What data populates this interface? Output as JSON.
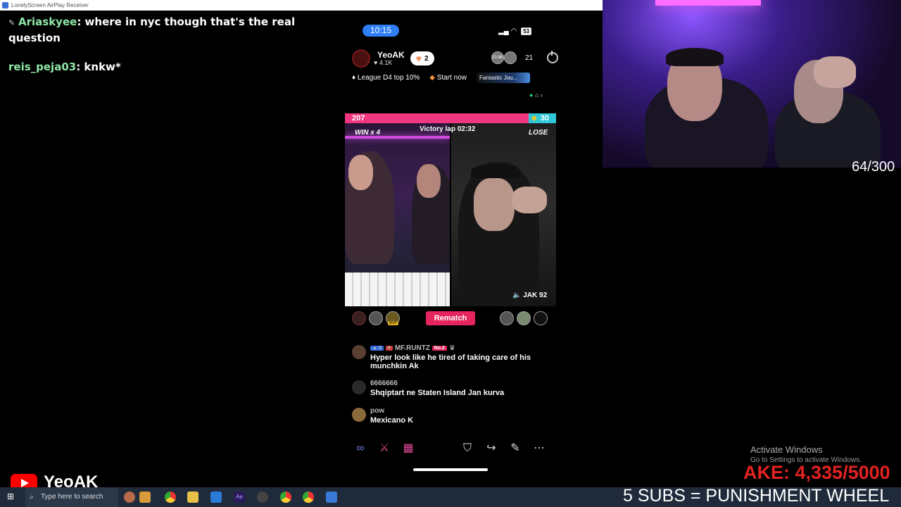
{
  "window": {
    "title": "LonelyScreen AirPlay Receiver"
  },
  "chat": [
    {
      "user": "Ariaskyee",
      "message": ": where in nyc though that's the real question"
    },
    {
      "user": "reis_peja03",
      "message": ": knkw*"
    }
  ],
  "phone": {
    "status": {
      "time": "10:15",
      "battery": "53"
    },
    "host": {
      "name": "YeoAK",
      "likes": "4.1K",
      "heart_count": "2"
    },
    "viewers": {
      "count": "21",
      "avatar_text": "10.8K"
    },
    "chips": {
      "league": "League D4 top 10%",
      "start": "Start now",
      "fantastic": "Fantastic Jou..."
    },
    "battle": {
      "score_left": "207",
      "score_right": "30",
      "left_ratio": 0.87,
      "win_label": "WIN x 4",
      "victory_text": "Victory lap 02:32",
      "lose_label": "LOSE",
      "opponent_tag": "JAK 92",
      "rematch_label": "Rematch",
      "mvp_label": "MVP"
    },
    "comments": [
      {
        "name": "MF.RUNTZ",
        "level": "3",
        "rank": "No.2",
        "text": "Hyper look like he tired of taking care of his munchkin Ak"
      },
      {
        "name": "6666666",
        "text": "Shqiptart ne Staten Island Jan kurva"
      },
      {
        "name": "pow",
        "text": "Mexicano K"
      }
    ]
  },
  "overlay": {
    "sub_counter": "64/300",
    "activate_title": "Activate Windows",
    "activate_sub": "Go to Settings to activate Windows.",
    "goal_text": "AKE: 4,335/5000",
    "punishment_text": "5 SUBS = PUNISHMENT WHEEL",
    "youtube_name": "YeoAK"
  },
  "taskbar": {
    "search_placeholder": "Type here to search"
  },
  "colors": {
    "chat_user": "#8ee6a6",
    "battle_pink": "#f0377f",
    "battle_cyan": "#2fc7d8",
    "rematch": "#e6245e",
    "goal_red": "#e32222"
  }
}
